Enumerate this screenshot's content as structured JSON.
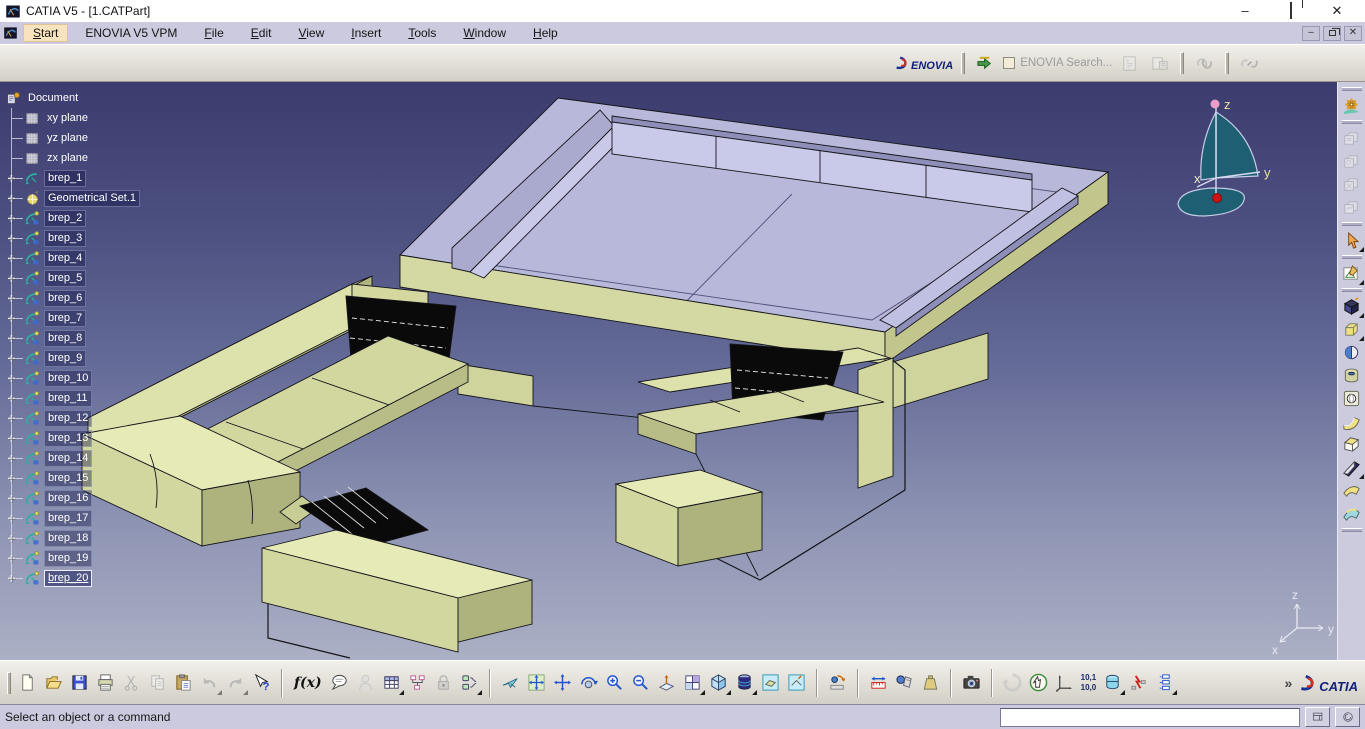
{
  "window": {
    "title": "CATIA V5 - [1.CATPart]"
  },
  "glyphs": {
    "minimize": "–",
    "close": "✕",
    "fx": "f(x)",
    "chevrons": "»",
    "snap_top": "10,1",
    "snap_bottom": "10,0"
  },
  "menubar": {
    "items": [
      {
        "label": "Start",
        "u": 0,
        "hl": true
      },
      {
        "label": "ENOVIA V5 VPM",
        "u": -1
      },
      {
        "label": "File",
        "u": 0
      },
      {
        "label": "Edit",
        "u": 0
      },
      {
        "label": "View",
        "u": 0
      },
      {
        "label": "Insert",
        "u": 0
      },
      {
        "label": "Tools",
        "u": 0
      },
      {
        "label": "Window",
        "u": 0
      },
      {
        "label": "Help",
        "u": 0
      }
    ]
  },
  "enovia": {
    "search_label": "ENOVIA Search...",
    "items": [
      {
        "t": "logo-enovia"
      },
      {
        "t": "h"
      },
      {
        "t": "i",
        "n": "transfer"
      },
      {
        "t": "cb",
        "n": "enovia-search-checkbox"
      },
      {
        "t": "txt",
        "n": "enovia-search-label",
        "b": "enovia.search_label",
        "cls": "graytxt"
      },
      {
        "t": "i",
        "n": "address-book",
        "g": 1
      },
      {
        "t": "i",
        "n": "save-db",
        "g": 1
      },
      {
        "t": "h"
      },
      {
        "t": "i",
        "n": "link",
        "g": 1
      },
      {
        "t": "h"
      },
      {
        "t": "i",
        "n": "unlink",
        "g": 1
      }
    ]
  },
  "tree": {
    "root": "Document",
    "items": [
      {
        "label": "xy plane",
        "type": "plane"
      },
      {
        "label": "yz plane",
        "type": "plane"
      },
      {
        "label": "zx plane",
        "type": "plane"
      },
      {
        "label": "brep_1",
        "type": "brep-plain",
        "exp": true,
        "box": true
      },
      {
        "label": "Geometrical Set.1",
        "type": "geoset",
        "exp": true,
        "box": true
      },
      {
        "label": "brep_2",
        "type": "brep",
        "exp": true,
        "box": true
      },
      {
        "label": "brep_3",
        "type": "brep",
        "exp": true,
        "box": true
      },
      {
        "label": "brep_4",
        "type": "brep",
        "exp": true,
        "box": true
      },
      {
        "label": "brep_5",
        "type": "brep",
        "exp": true,
        "box": true
      },
      {
        "label": "brep_6",
        "type": "brep",
        "exp": true,
        "box": true
      },
      {
        "label": "brep_7",
        "type": "brep",
        "exp": true,
        "box": true
      },
      {
        "label": "brep_8",
        "type": "brep",
        "exp": true,
        "box": true
      },
      {
        "label": "brep_9",
        "type": "brep",
        "exp": true,
        "box": true
      },
      {
        "label": "brep_10",
        "type": "brep",
        "exp": true,
        "box": true
      },
      {
        "label": "brep_11",
        "type": "brep",
        "exp": true,
        "box": true
      },
      {
        "label": "brep_12",
        "type": "brep",
        "exp": true,
        "box": true
      },
      {
        "label": "brep_13",
        "type": "brep",
        "exp": true,
        "box": true
      },
      {
        "label": "brep_14",
        "type": "brep",
        "exp": true,
        "box": true
      },
      {
        "label": "brep_15",
        "type": "brep",
        "exp": true,
        "box": true
      },
      {
        "label": "brep_16",
        "type": "brep",
        "exp": true,
        "box": true
      },
      {
        "label": "brep_17",
        "type": "brep",
        "exp": true,
        "box": true
      },
      {
        "label": "brep_18",
        "type": "brep",
        "exp": true,
        "box": true
      },
      {
        "label": "brep_19",
        "type": "brep",
        "exp": true,
        "box": true
      },
      {
        "label": "brep_20",
        "type": "brep",
        "exp": true,
        "box": true,
        "selected": true
      }
    ]
  },
  "compass": {
    "x": "x",
    "y": "y",
    "z": "z"
  },
  "triad": {
    "x": "x",
    "y": "y",
    "z": "z"
  },
  "toolbars": {
    "right": [
      {
        "t": "h"
      },
      {
        "t": "i",
        "n": "settings-gear"
      },
      {
        "t": "h"
      },
      {
        "t": "i",
        "n": "pdm-a",
        "g": 1
      },
      {
        "t": "i",
        "n": "pdm-b",
        "g": 1
      },
      {
        "t": "i",
        "n": "pdm-c",
        "g": 1
      },
      {
        "t": "i",
        "n": "pdm-d",
        "g": 1
      },
      {
        "t": "h"
      },
      {
        "t": "i",
        "n": "select",
        "f": 1
      },
      {
        "t": "h"
      },
      {
        "t": "i",
        "n": "sketcher",
        "f": 1
      },
      {
        "t": "h"
      },
      {
        "t": "i",
        "n": "prism",
        "f": 1
      },
      {
        "t": "i",
        "n": "pad",
        "f": 1
      },
      {
        "t": "i",
        "n": "split"
      },
      {
        "t": "i",
        "n": "groove"
      },
      {
        "t": "i",
        "n": "hole"
      },
      {
        "t": "i",
        "n": "fillet-surface"
      },
      {
        "t": "i",
        "n": "chamfer"
      },
      {
        "t": "i",
        "n": "close-surface",
        "f": 1
      },
      {
        "t": "i",
        "n": "sew-surface"
      },
      {
        "t": "i",
        "n": "thick-surface"
      },
      {
        "t": "h"
      }
    ],
    "bottom": [
      {
        "t": "h"
      },
      {
        "t": "i",
        "n": "new-file"
      },
      {
        "t": "i",
        "n": "open-file"
      },
      {
        "t": "i",
        "n": "save"
      },
      {
        "t": "i",
        "n": "print"
      },
      {
        "t": "i",
        "n": "cut",
        "g": 1
      },
      {
        "t": "i",
        "n": "copy",
        "g": 1
      },
      {
        "t": "i",
        "n": "paste"
      },
      {
        "t": "i",
        "n": "undo",
        "g": 1,
        "f": 1
      },
      {
        "t": "i",
        "n": "redo",
        "g": 1,
        "f": 1
      },
      {
        "t": "i",
        "n": "whats-this"
      },
      {
        "t": "s"
      },
      {
        "t": "txt",
        "n": "fx-formula",
        "b": "glyphs.fx",
        "cls": "fxtxt"
      },
      {
        "t": "i",
        "n": "knowledge-chat"
      },
      {
        "t": "i",
        "n": "hidden-user",
        "g": 1
      },
      {
        "t": "i",
        "n": "design-table",
        "f": 1
      },
      {
        "t": "i",
        "n": "product-structure"
      },
      {
        "t": "i",
        "n": "lock",
        "g": 1
      },
      {
        "t": "i",
        "n": "check-rules",
        "f": 1
      },
      {
        "t": "s"
      },
      {
        "t": "i",
        "n": "fly-mode"
      },
      {
        "t": "i",
        "n": "fit-all-in"
      },
      {
        "t": "i",
        "n": "pan"
      },
      {
        "t": "i",
        "n": "rotate"
      },
      {
        "t": "i",
        "n": "zoom-in"
      },
      {
        "t": "i",
        "n": "zoom-out"
      },
      {
        "t": "i",
        "n": "normal-view"
      },
      {
        "t": "i",
        "n": "quad-view",
        "f": 1
      },
      {
        "t": "i",
        "n": "iso-view",
        "f": 1
      },
      {
        "t": "i",
        "n": "render-style",
        "f": 1
      },
      {
        "t": "i",
        "n": "view-mode"
      },
      {
        "t": "i",
        "n": "view-mode-alt"
      },
      {
        "t": "s"
      },
      {
        "t": "i",
        "n": "turntable"
      },
      {
        "t": "s"
      },
      {
        "t": "i",
        "n": "measure-between"
      },
      {
        "t": "i",
        "n": "measure-item"
      },
      {
        "t": "i",
        "n": "measure-inertia"
      },
      {
        "t": "s"
      },
      {
        "t": "i",
        "n": "capture"
      },
      {
        "t": "s"
      },
      {
        "t": "i",
        "n": "refresh",
        "g": 1
      },
      {
        "t": "i",
        "n": "swap-visible-space"
      },
      {
        "t": "i",
        "n": "axis-system"
      },
      {
        "t": "snap",
        "n": "snap-indicator"
      },
      {
        "t": "i",
        "n": "cylindrical-tool",
        "f": 1
      },
      {
        "t": "i",
        "n": "knowledge-inspector"
      },
      {
        "t": "i",
        "n": "edit-list",
        "f": 1
      },
      {
        "t": "sp"
      },
      {
        "t": "txt",
        "n": "overflow-chevrons",
        "b": "glyphs.chevrons",
        "cls": "chev"
      },
      {
        "t": "logo",
        "n": "catia-logo"
      }
    ]
  },
  "statusbar": {
    "message": "Select an object or a command",
    "input_value": ""
  },
  "logos": {
    "catia": "CATIA",
    "enovia": "ENOVIA"
  }
}
